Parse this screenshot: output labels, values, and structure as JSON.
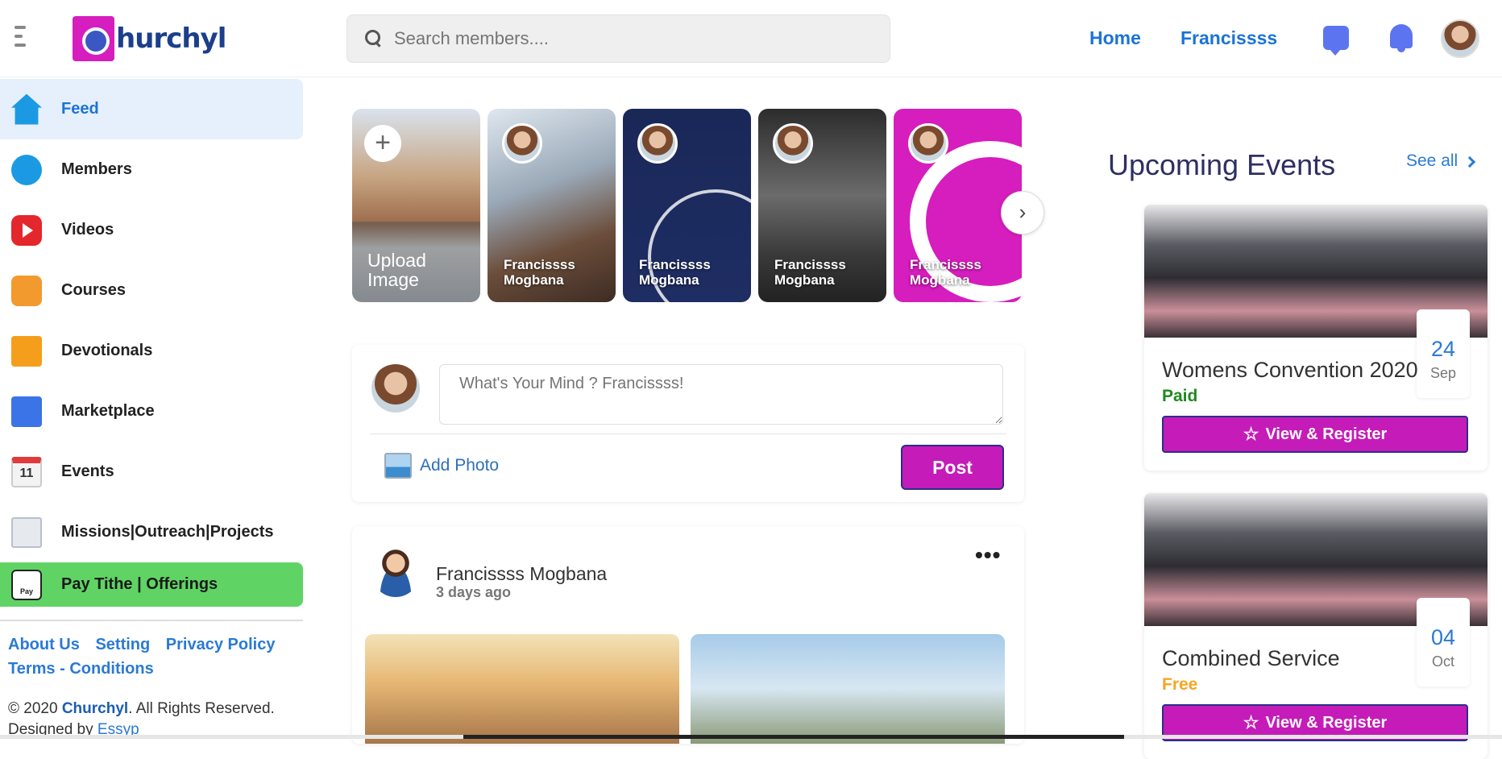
{
  "app": {
    "name": "Churchyl"
  },
  "logo_text": "hurchyl",
  "search": {
    "placeholder": "Search members...."
  },
  "topnav": {
    "home": "Home",
    "user": "Francissss"
  },
  "sidebar": {
    "items": [
      {
        "label": "Feed",
        "icon": "home-icon"
      },
      {
        "label": "Members",
        "icon": "members-icon"
      },
      {
        "label": "Videos",
        "icon": "videos-icon"
      },
      {
        "label": "Courses",
        "icon": "courses-icon"
      },
      {
        "label": "Devotionals",
        "icon": "book-icon"
      },
      {
        "label": "Marketplace",
        "icon": "store-icon"
      },
      {
        "label": "Events",
        "icon": "calendar-icon",
        "badge": "11"
      },
      {
        "label": "Missions|Outreach|Projects",
        "icon": "document-icon"
      }
    ],
    "tithe": {
      "label": "Pay Tithe | Offerings",
      "icon_text": "Pay"
    },
    "links": [
      "About Us",
      "Setting",
      "Privacy Policy",
      "Terms - Conditions"
    ],
    "copyright_prefix": "© 2020 ",
    "copyright_brand": "Churchyl",
    "copyright_suffix": ". All Rights Reserved.",
    "designed_by": "Designed by ",
    "designer": "Essyp"
  },
  "stories": {
    "upload_label": "Upload Image",
    "items": [
      {
        "first": "Francissss",
        "last": "Mogbana"
      },
      {
        "first": "Francissss",
        "last": "Mogbana"
      },
      {
        "first": "Francissss",
        "last": "Mogbana"
      },
      {
        "first": "Francissss",
        "last": "Mogbana"
      }
    ]
  },
  "composer": {
    "placeholder": "What's Your Mind ? Francissss!",
    "add_photo": "Add Photo",
    "post_label": "Post"
  },
  "post": {
    "author": "Francissss Mogbana",
    "time": "3 days ago",
    "more": "•••"
  },
  "events": {
    "title": "Upcoming Events",
    "see_all": "See all",
    "items": [
      {
        "title": "Womens Convention 2020",
        "price": "Paid",
        "price_color": "#1f8a1f",
        "day": "24",
        "month": "Sep",
        "button": "View & Register"
      },
      {
        "title": "Combined Service",
        "price": "Free",
        "price_color": "#f5a623",
        "day": "04",
        "month": "Oct",
        "button": "View & Register"
      }
    ]
  },
  "colors": {
    "brand_magenta": "#c51bb9",
    "link_blue": "#1a73d9",
    "tithe_green": "#5fd465"
  }
}
